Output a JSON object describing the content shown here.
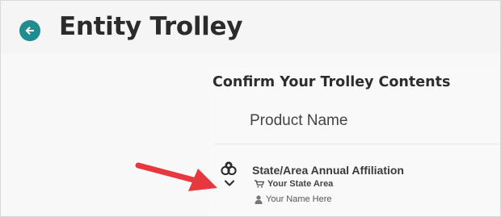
{
  "header": {
    "title": "Entity Trolley",
    "back_icon": "back-arrow-circle-icon",
    "back_color": "#1f8d8f"
  },
  "trolley": {
    "heading": "Confirm Your Trolley Contents",
    "column_header": "Product Name",
    "items": [
      {
        "icon": "products-icon",
        "expand_icon": "chevron-down-icon",
        "name": "State/Area Annual Affiliation",
        "area": "Your State Area",
        "member": "Your Name Here"
      }
    ]
  },
  "annotation": {
    "arrow_color": "#e8383f"
  }
}
